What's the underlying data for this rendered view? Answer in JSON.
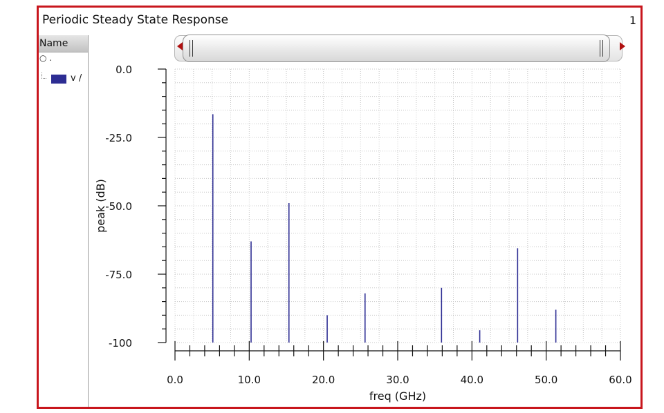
{
  "window": {
    "title": "Periodic Steady State Response",
    "plot_number": "1"
  },
  "side_panel": {
    "header": "Name",
    "legend_label": "v /"
  },
  "chart_data": {
    "type": "bar",
    "style": "stem",
    "xlabel": "freq (GHz)",
    "ylabel": "peak (dB)",
    "xlim": [
      0,
      60
    ],
    "ylim": [
      -100,
      0
    ],
    "x_ticks": [
      "0.0",
      "10.0",
      "20.0",
      "30.0",
      "40.0",
      "50.0",
      "60.0"
    ],
    "y_ticks": [
      "0.0",
      "-25.0",
      "-50.0",
      "-75.0",
      "-100"
    ],
    "grid": true,
    "series": [
      {
        "name": "v /",
        "color": "#2d2d93",
        "x": [
          5.1,
          10.25,
          15.35,
          20.5,
          25.6,
          35.9,
          41.05,
          46.15,
          51.3
        ],
        "y": [
          -16.5,
          -63,
          -49,
          -90,
          -82,
          -80,
          -95.5,
          -65.5,
          -88
        ]
      }
    ]
  }
}
